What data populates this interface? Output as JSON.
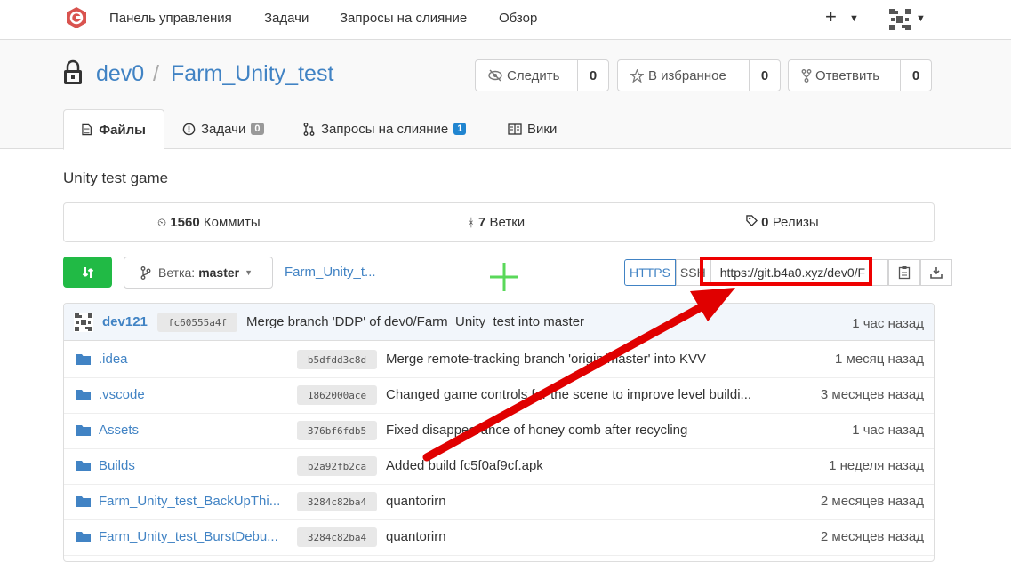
{
  "topnav": {
    "items": [
      "Панель управления",
      "Задачи",
      "Запросы на слияние",
      "Обзор"
    ],
    "plus": "+"
  },
  "repo": {
    "owner": "dev0",
    "separator": "/",
    "name": "Farm_Unity_test",
    "watch_label": "Следить",
    "watch_count": "0",
    "star_label": "В избранное",
    "star_count": "0",
    "fork_label": "Ответвить",
    "fork_count": "0"
  },
  "tabs": [
    {
      "label": "Файлы"
    },
    {
      "label": "Задачи",
      "badge": "0"
    },
    {
      "label": "Запросы на слияние",
      "badge": "1"
    },
    {
      "label": "Вики"
    }
  ],
  "description": "Unity test game",
  "stats": {
    "commits_count": "1560",
    "commits_label": "Коммиты",
    "branches_count": "7",
    "branches_label": "Ветки",
    "releases_count": "0",
    "releases_label": "Релизы"
  },
  "toolbar": {
    "branch_label": "Ветка:",
    "branch_value": "master",
    "breadcrumb": "Farm_Unity_t...",
    "https_label": "HTTPS",
    "ssh_label": "SSH",
    "clone_url": "https://git.b4a0.xyz/dev0/F"
  },
  "latest_commit": {
    "author": "dev121",
    "sha": "fc60555a4f",
    "message": "Merge branch 'DDP' of dev0/Farm_Unity_test into master",
    "time": "1 час назад"
  },
  "files": [
    {
      "name": ".idea",
      "sha": "b5dfdd3c8d",
      "message": "Merge remote-tracking branch 'origin/master' into KVV",
      "time": "1 месяц назад"
    },
    {
      "name": ".vscode",
      "sha": "1862000ace",
      "message": "Changed game controls for the scene to improve level buildi...",
      "time": "3 месяцев назад"
    },
    {
      "name": "Assets",
      "sha": "376bf6fdb5",
      "message": "Fixed disappearance of honey comb after recycling",
      "time": "1 час назад"
    },
    {
      "name": "Builds",
      "sha": "b2a92fb2ca",
      "message": "Added build fc5f0af9cf.apk",
      "time": "1 неделя назад"
    },
    {
      "name": "Farm_Unity_test_BackUpThi...",
      "sha": "3284c82ba4",
      "message": "quantorirn",
      "time": "2 месяцев назад"
    },
    {
      "name": "Farm_Unity_test_BurstDebu...",
      "sha": "3284c82ba4",
      "message": "quantorirn",
      "time": "2 месяцев назад"
    }
  ],
  "colors": {
    "link": "#4183c4",
    "green": "#21ba45",
    "annotation_red": "#e00000",
    "badge_grey": "#999999",
    "badge_blue": "#2185d0"
  }
}
